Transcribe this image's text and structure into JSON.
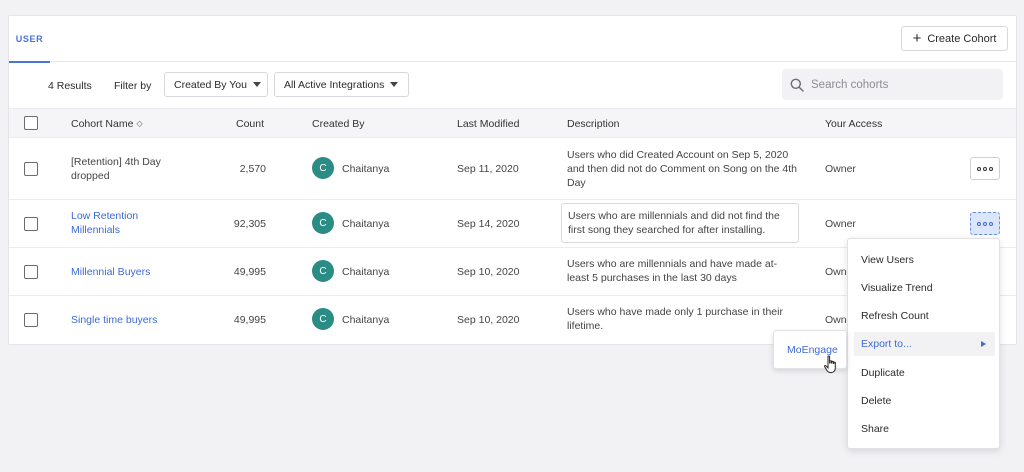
{
  "tabs": {
    "user": "USER"
  },
  "header": {
    "create_button": "Create Cohort"
  },
  "filters": {
    "results": "4 Results",
    "filter_by": "Filter by",
    "created_by": "Created By You",
    "integrations": "All Active Integrations",
    "search_placeholder": "Search cohorts"
  },
  "table": {
    "columns": [
      "Cohort Name",
      "Count",
      "Created By",
      "Last Modified",
      "Description",
      "Your Access"
    ],
    "rows": [
      {
        "name_line1": "[Retention] 4th Day",
        "name_line2": "dropped",
        "count": "2,570",
        "avatar": "C",
        "creator": "Chaitanya",
        "modified": "Sep 11, 2020",
        "description": "Users who did Created Account on Sep 5, 2020 and then did not do Comment on Song on the 4th Day",
        "access": "Owner"
      },
      {
        "name_line1": "Low Retention",
        "name_line2": "Millennials",
        "count": "92,305",
        "avatar": "C",
        "creator": "Chaitanya",
        "modified": "Sep 14, 2020",
        "description": "Users who are millennials and did not find the first song they searched for after installing.",
        "access": "Owner"
      },
      {
        "name_line1": "Millennial Buyers",
        "count": "49,995",
        "avatar": "C",
        "creator": "Chaitanya",
        "modified": "Sep 10, 2020",
        "description": "Users who are millennials and have made at-least 5 purchases in the last 30 days",
        "access": "Owner"
      },
      {
        "name_line1": "Single time buyers",
        "count": "49,995",
        "avatar": "C",
        "creator": "Chaitanya",
        "modified": "Sep 10, 2020",
        "description": "Users who have made only 1 purchase in their lifetime.",
        "access": "Owner"
      }
    ]
  },
  "menu": {
    "items": [
      "View Users",
      "Visualize Trend",
      "Refresh Count",
      "Export to...",
      "Duplicate",
      "Delete",
      "Share"
    ]
  },
  "submenu": {
    "item": "MoEngage"
  },
  "colors": {
    "accent": "#3d6ad6",
    "avatar": "#2a8c84"
  },
  "icons": {
    "search": "search-icon",
    "more": "more-icon",
    "sort": "sort-icon",
    "plus": "plus-icon",
    "cursor": "hand-cursor-icon"
  }
}
